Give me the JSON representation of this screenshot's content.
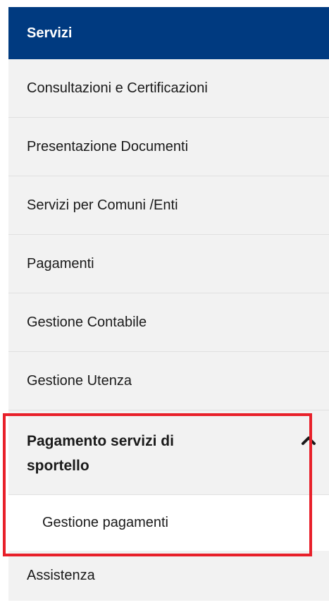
{
  "menu": {
    "header": "Servizi",
    "items": [
      {
        "label": "Consultazioni e Certificazioni"
      },
      {
        "label": "Presentazione Documenti"
      },
      {
        "label": "Servizi per Comuni /Enti"
      },
      {
        "label": "Pagamenti"
      },
      {
        "label": "Gestione Contabile"
      },
      {
        "label": "Gestione Utenza"
      }
    ],
    "expanded": {
      "title": "Pagamento servizi di sportello",
      "chevron_icon": "chevron-up-icon",
      "subitems": [
        {
          "label": "Gestione pagamenti"
        }
      ]
    },
    "after_items": [
      {
        "label": "Assistenza"
      }
    ]
  },
  "colors": {
    "header_bg": "#003a80",
    "item_bg": "#f2f2f2",
    "highlight": "#e8202a"
  }
}
